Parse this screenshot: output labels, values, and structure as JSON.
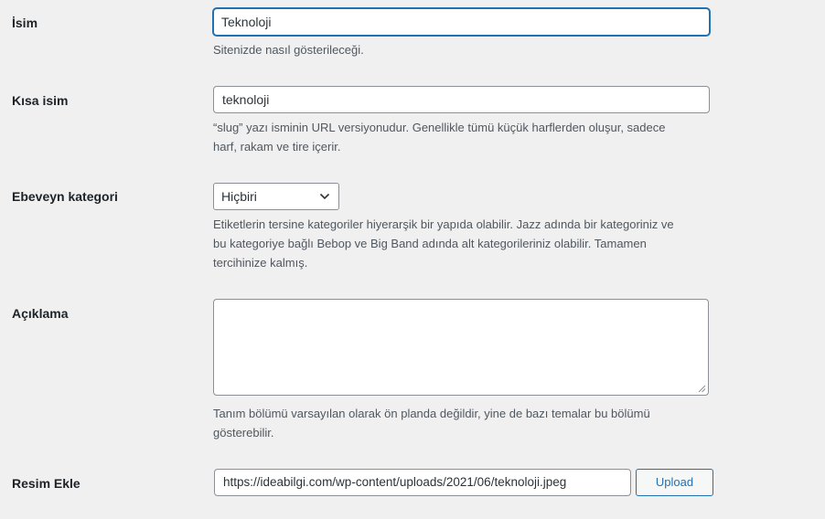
{
  "fields": {
    "name": {
      "label": "İsim",
      "value": "Teknoloji",
      "description": "Sitenizde nasıl gösterileceği."
    },
    "slug": {
      "label": "Kısa isim",
      "value": "teknoloji",
      "description_line1": "“slug” yazı isminin URL versiyonudur. Genellikle tümü küçük harflerden oluşur, sadece",
      "description_line2": "harf, rakam ve tire içerir."
    },
    "parent": {
      "label": "Ebeveyn kategori",
      "selected": "Hiçbiri",
      "description_line1": "Etiketlerin tersine kategoriler hiyerarşik bir yapıda olabilir. Jazz adında bir kategoriniz ve",
      "description_line2": "bu kategoriye bağlı Bebop ve Big Band adında alt kategorileriniz olabilir. Tamamen",
      "description_line3": "tercihinize kalmış."
    },
    "description": {
      "label": "Açıklama",
      "value": "",
      "description_line1": "Tanım bölümü varsayılan olarak ön planda değildir, yine de bazı temalar bu bölümü",
      "description_line2": "gösterebilir."
    },
    "image": {
      "label": "Resim Ekle",
      "value": "https://ideabilgi.com/wp-content/uploads/2021/06/teknoloji.jpeg",
      "button_label": "Upload"
    }
  },
  "icons": {
    "select_arrow": "chevron-down-icon",
    "textarea_grip": "resize-grip-icon"
  },
  "colors": {
    "accent": "#2271b1",
    "background": "#f0f0f1",
    "text": "#1d2327",
    "muted": "#50575e"
  }
}
